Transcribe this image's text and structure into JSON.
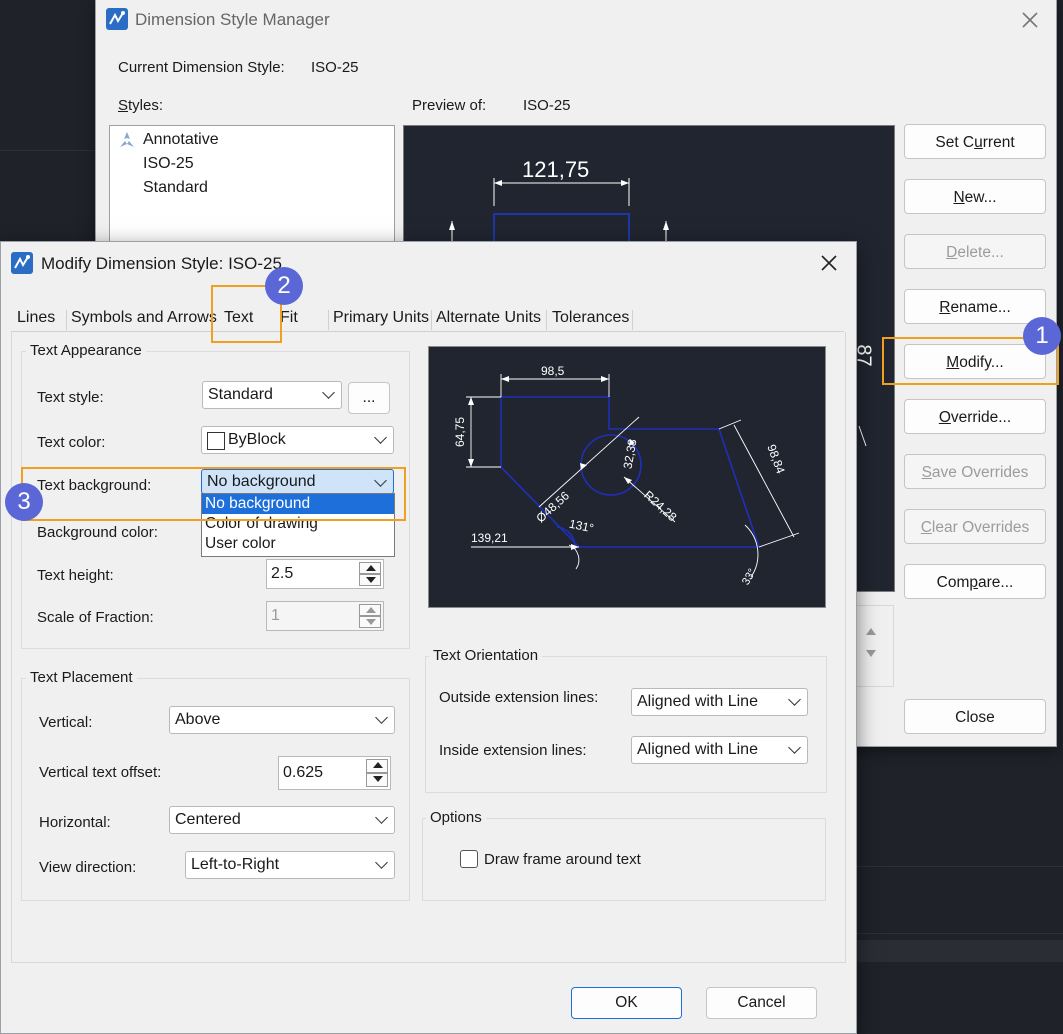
{
  "dsm": {
    "title": "Dimension Style Manager",
    "current_label": "Current Dimension Style:",
    "current_value": "ISO-25",
    "styles_label": "Styles:",
    "preview_label": "Preview of:",
    "preview_value": "ISO-25",
    "styles": [
      "Annotative",
      "ISO-25",
      "Standard"
    ],
    "preview_dim": "121,75",
    "preview_side": "87",
    "buttons": [
      "Set Current",
      "New...",
      "Delete...",
      "Rename...",
      "Modify...",
      "Override...",
      "Save Overrides",
      "Clear Overrides",
      "Compare...",
      "Close"
    ]
  },
  "badges": [
    "1",
    "2",
    "3"
  ],
  "mod": {
    "title": "Modify Dimension Style: ISO-25",
    "tabs": [
      "Lines",
      "Symbols and Arrows",
      "Text",
      "Fit",
      "Primary Units",
      "Alternate Units",
      "Tolerances"
    ],
    "appearance": {
      "title": "Text Appearance",
      "text_style_label": "Text style:",
      "text_style_value": "Standard",
      "ellipsis": "...",
      "text_color_label": "Text color:",
      "text_color_value": "ByBlock",
      "text_bg_label": "Text background:",
      "text_bg_value": "No background",
      "bg_options": [
        "No background",
        "Color of drawing",
        "User color"
      ],
      "bg_color_label": "Background color:",
      "text_height_label": "Text height:",
      "text_height_value": "2.5",
      "scale_label": "Scale of Fraction:",
      "scale_value": "1"
    },
    "placement": {
      "title": "Text Placement",
      "vertical_label": "Vertical:",
      "vertical_value": "Above",
      "offset_label": "Vertical text offset:",
      "offset_value": "0.625",
      "horizontal_label": "Horizontal:",
      "horizontal_value": "Centered",
      "view_label": "View direction:",
      "view_value": "Left-to-Right"
    },
    "orientation": {
      "title": "Text Orientation",
      "outside_label": "Outside extension lines:",
      "outside_value": "Aligned with Line",
      "inside_label": "Inside extension lines:",
      "inside_value": "Aligned with Line"
    },
    "options": {
      "title": "Options",
      "frame_label": "Draw frame around text"
    },
    "preview": {
      "d1": "98,5",
      "d2": "64,75",
      "d3": "32,38",
      "d4": "98,84",
      "d5": "Ø48,56",
      "d6": "R24,28",
      "d7": "131°",
      "d8": "139,21",
      "d9": "33°"
    },
    "ok": "OK",
    "cancel": "Cancel"
  }
}
